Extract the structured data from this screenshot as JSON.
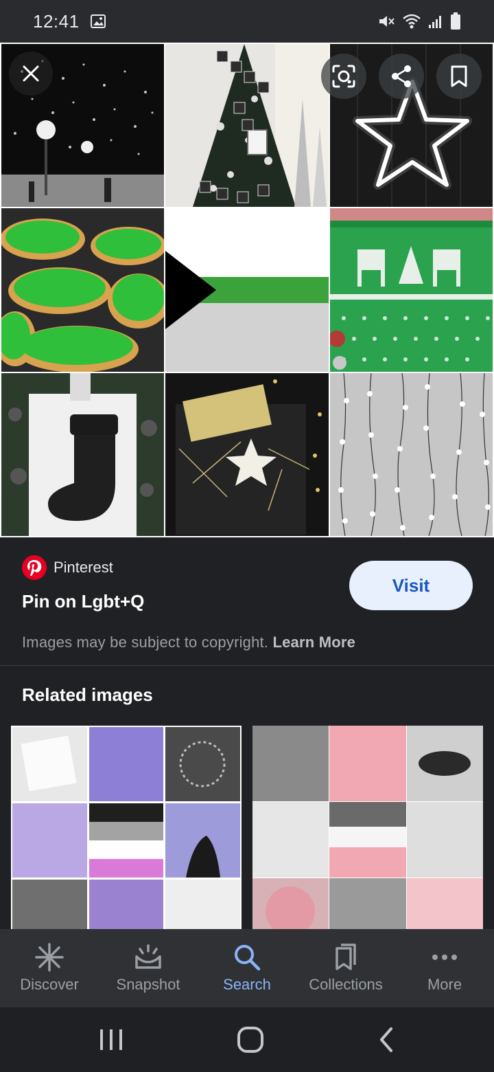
{
  "status": {
    "time": "12:41",
    "icons": [
      "image-icon",
      "mute-icon",
      "wifi-icon",
      "signal-icon",
      "battery-icon"
    ]
  },
  "hero": {
    "tiles": [
      "snowy-park-lights",
      "christmas-tree-merry-joy-peace",
      "neon-star",
      "green-tree-cookies",
      "demisexual-flag",
      "green-reindeer-sweater",
      "black-stocking-wreath",
      "black-gold-gift",
      "string-lights"
    ],
    "actions": [
      "close-icon",
      "lens-icon",
      "share-icon",
      "bookmark-icon"
    ]
  },
  "source": {
    "site": "Pinterest",
    "title": "Pin on Lgbt+Q",
    "visit_label": "Visit",
    "copyright_text": "Images may be subject to copyright.",
    "learn_more": "Learn More",
    "brand_color": "#e60023"
  },
  "related": {
    "heading": "Related images"
  },
  "bottom_nav": {
    "items": [
      {
        "label": "Discover",
        "icon": "asterisk-icon",
        "active": false
      },
      {
        "label": "Snapshot",
        "icon": "snapshot-icon",
        "active": false
      },
      {
        "label": "Search",
        "icon": "search-icon",
        "active": true
      },
      {
        "label": "Collections",
        "icon": "collections-icon",
        "active": false
      },
      {
        "label": "More",
        "icon": "more-dots-icon",
        "active": false
      }
    ],
    "active_color": "#8ab4f8"
  },
  "system_nav": [
    "recents-icon",
    "home-icon",
    "back-icon"
  ]
}
